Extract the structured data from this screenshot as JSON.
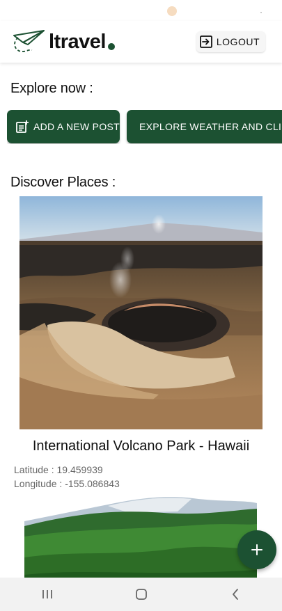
{
  "status_bar": {},
  "header": {
    "logo_text": "ltravel",
    "logout_label": "LOGOUT"
  },
  "explore": {
    "title": "Explore now :",
    "actions": [
      {
        "label": "ADD A NEW POST",
        "icon": "post-add-icon"
      },
      {
        "label": "EXPLORE WEATHER AND CLIMATE",
        "icon": "cloud-icon"
      }
    ]
  },
  "discover": {
    "title": "Discover Places :",
    "places": [
      {
        "name": "International Volcano Park - Hawaii",
        "latitude_label": "Latitude :",
        "latitude": "19.459939",
        "longitude_label": "Longitude :",
        "longitude": "-155.086843",
        "image": "volcano-crater-photo"
      },
      {
        "image": "forest-mountain-photo"
      }
    ]
  },
  "fab": {
    "icon": "plus-icon"
  },
  "nav_bar": {
    "items": [
      "recent-apps-icon",
      "home-icon",
      "back-icon"
    ]
  },
  "colors": {
    "primary": "#1c5132",
    "background": "#ffffff",
    "text": "#111111",
    "muted": "#666666"
  }
}
